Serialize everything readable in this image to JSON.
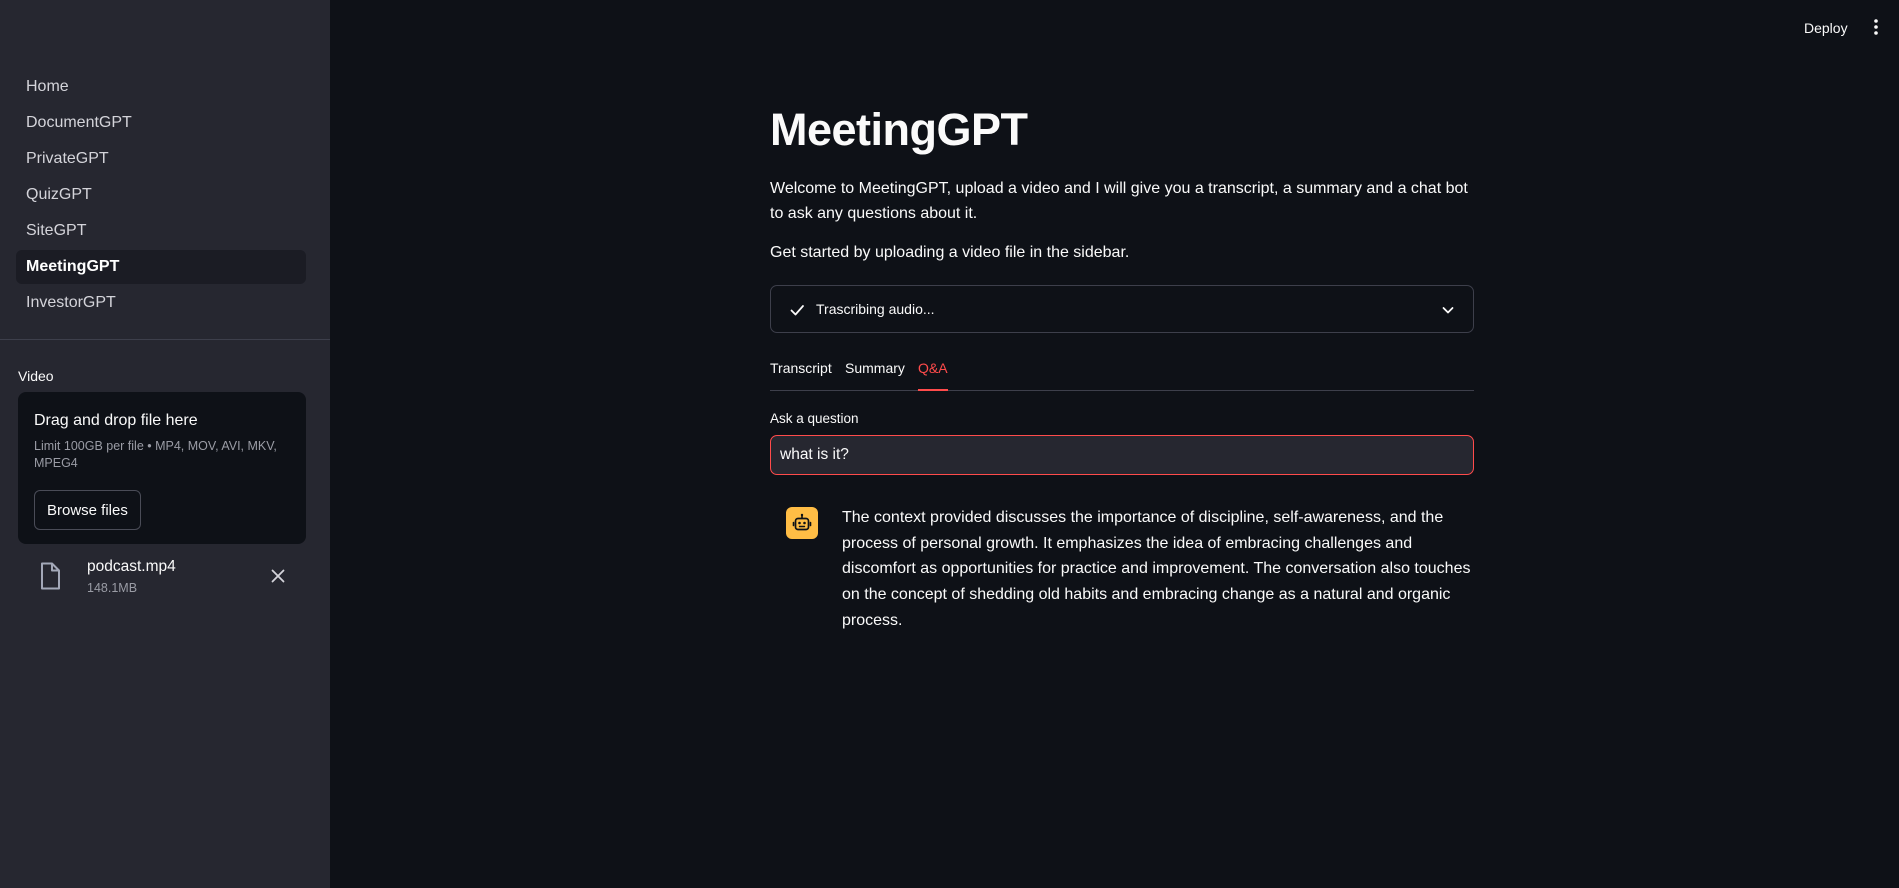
{
  "header": {
    "deploy_label": "Deploy",
    "menu_icon": "kebab-menu-icon"
  },
  "sidebar": {
    "items": [
      {
        "label": "Home",
        "active": false
      },
      {
        "label": "DocumentGPT",
        "active": false
      },
      {
        "label": "PrivateGPT",
        "active": false
      },
      {
        "label": "QuizGPT",
        "active": false
      },
      {
        "label": "SiteGPT",
        "active": false
      },
      {
        "label": "MeetingGPT",
        "active": true
      },
      {
        "label": "InvestorGPT",
        "active": false
      }
    ],
    "uploader": {
      "label": "Video",
      "drop_title": "Drag and drop file here",
      "drop_subtitle": "Limit 100GB per file • MP4, MOV, AVI, MKV, MPEG4",
      "browse_label": "Browse files",
      "file": {
        "name": "podcast.mp4",
        "size": "148.1MB",
        "icon": "file-icon",
        "remove_icon": "close-icon"
      }
    }
  },
  "main": {
    "title": "MeetingGPT",
    "welcome": "Welcome to MeetingGPT, upload a video and I will give you a transcript, a summary and a chat bot to ask any questions about it.",
    "get_started": "Get started by uploading a video file in the sidebar.",
    "status": {
      "text": "Trascribing audio...",
      "icon": "check-icon",
      "expand_icon": "chevron-down-icon"
    },
    "tabs": [
      {
        "label": "Transcript",
        "active": false
      },
      {
        "label": "Summary",
        "active": false
      },
      {
        "label": "Q&A",
        "active": true
      }
    ],
    "question": {
      "label": "Ask a question",
      "value": "what is it?"
    },
    "answer": {
      "avatar_icon": "robot-icon",
      "avatar_color": "#ffbd45",
      "text": "The context provided discusses the importance of discipline, self-awareness, and the process of personal growth. It emphasizes the idea of embracing challenges and discomfort as opportunities for practice and improvement. The conversation also touches on the concept of shedding old habits and embracing change as a natural and organic process."
    }
  },
  "colors": {
    "background": "#0e1117",
    "sidebar": "#262730",
    "accent": "#ff4b4b",
    "text": "#fafafa"
  }
}
